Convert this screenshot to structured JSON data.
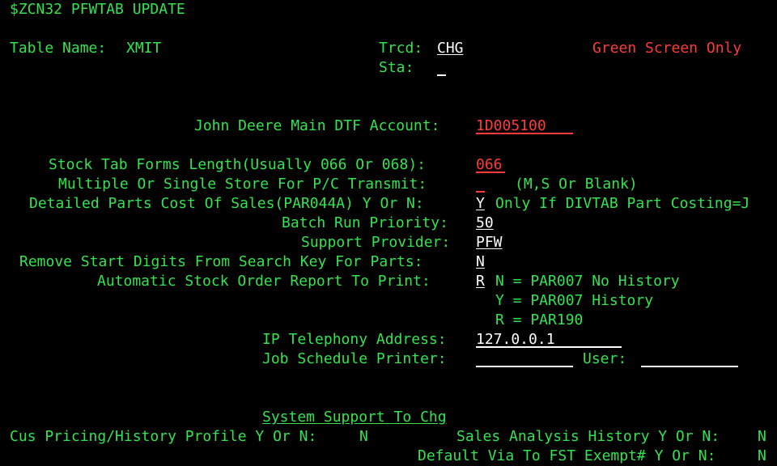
{
  "header": {
    "title": "$ZCN32 PFWTAB UPDATE",
    "table_name_label": "Table Name:",
    "table_name_value": "XMIT",
    "trcd_label": "Trcd:",
    "trcd_value": "CHG",
    "sta_label": "Sta:",
    "sta_value": "",
    "notice": "Green Screen Only"
  },
  "fields": {
    "dtf_account_label": "John Deere Main DTF Account:",
    "dtf_account_value": "1D005100",
    "stock_tab_label": "Stock Tab Forms Length(Usually 066 Or 068):",
    "stock_tab_value": "066",
    "multi_store_label": "Multiple Or Single Store For P/C Transmit:",
    "multi_store_value": "",
    "multi_store_hint": "(M,S Or Blank)",
    "parts_cost_label": "Detailed Parts Cost Of Sales(PAR044A) Y Or N:",
    "parts_cost_value": "Y",
    "parts_cost_hint": "Only If DIVTAB Part Costing=J",
    "batch_priority_label": "Batch Run Priority:",
    "batch_priority_value": "50",
    "support_provider_label": "Support Provider:",
    "support_provider_value": "PFW",
    "remove_digits_label": "Remove Start Digits From Search Key For Parts:",
    "remove_digits_value": "N",
    "auto_stock_label": "Automatic Stock Order Report To Print:",
    "auto_stock_value": "R",
    "auto_stock_option_n": "N = PAR007 No History",
    "auto_stock_option_y": "Y = PAR007 History",
    "auto_stock_option_r": "R = PAR190",
    "ip_label": "IP Telephony Address:",
    "ip_value": "127.0.0.1",
    "printer_label": "Job Schedule Printer:",
    "printer_value": "",
    "user_label": "User:",
    "user_value": ""
  },
  "system_support": {
    "heading": "System Support To Chg",
    "cus_pricing_label": "Cus Pricing/History Profile Y Or N:",
    "cus_pricing_value": "N",
    "sales_analysis_label": "Sales Analysis History Y Or N:",
    "sales_analysis_value": "N",
    "default_via_label": "Default Via To FST Exempt# Y Or N:",
    "default_via_value": "N"
  },
  "colors": {
    "background": "#000000",
    "label_green": "#33e34f",
    "alert_red": "#ff3a3a",
    "input_white": "#ffffff"
  }
}
